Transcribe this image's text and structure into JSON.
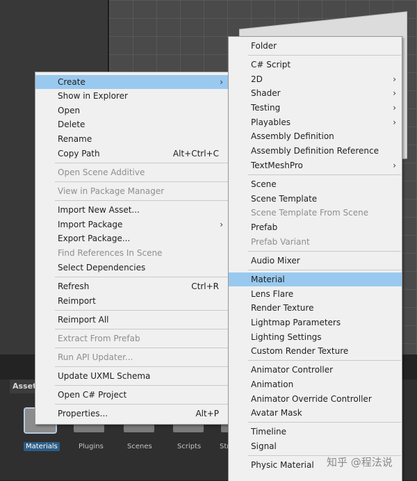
{
  "project": {
    "tab_label": "Asset",
    "folders": [
      "Materials",
      "Plugins",
      "Scenes",
      "Scripts",
      "Str"
    ],
    "selected_folder": "Materials"
  },
  "context_menu": {
    "items": {
      "create": "Create",
      "show_in_explorer": "Show in Explorer",
      "open": "Open",
      "delete": "Delete",
      "rename": "Rename",
      "copy_path": "Copy Path",
      "copy_path_shortcut": "Alt+Ctrl+C",
      "open_scene_additive": "Open Scene Additive",
      "view_in_package_manager": "View in Package Manager",
      "import_new_asset": "Import New Asset...",
      "import_package": "Import Package",
      "export_package": "Export Package...",
      "find_references": "Find References In Scene",
      "select_dependencies": "Select Dependencies",
      "refresh": "Refresh",
      "refresh_shortcut": "Ctrl+R",
      "reimport": "Reimport",
      "reimport_all": "Reimport All",
      "extract_from_prefab": "Extract From Prefab",
      "run_api_updater": "Run API Updater...",
      "update_uxml_schema": "Update UXML Schema",
      "open_csharp_project": "Open C# Project",
      "properties": "Properties...",
      "properties_shortcut": "Alt+P"
    }
  },
  "create_submenu": {
    "items": {
      "folder": "Folder",
      "csharp_script": "C# Script",
      "2d": "2D",
      "shader": "Shader",
      "testing": "Testing",
      "playables": "Playables",
      "assembly_definition": "Assembly Definition",
      "assembly_definition_reference": "Assembly Definition Reference",
      "textmeshpro": "TextMeshPro",
      "scene": "Scene",
      "scene_template": "Scene Template",
      "scene_template_from_scene": "Scene Template From Scene",
      "prefab": "Prefab",
      "prefab_variant": "Prefab Variant",
      "audio_mixer": "Audio Mixer",
      "material": "Material",
      "lens_flare": "Lens Flare",
      "render_texture": "Render Texture",
      "lightmap_parameters": "Lightmap Parameters",
      "lighting_settings": "Lighting Settings",
      "custom_render_texture": "Custom Render Texture",
      "animator_controller": "Animator Controller",
      "animation": "Animation",
      "animator_override_controller": "Animator Override Controller",
      "avatar_mask": "Avatar Mask",
      "timeline": "Timeline",
      "signal": "Signal",
      "physic_material": "Physic Material"
    }
  },
  "icons": {
    "submenu_arrow": "chevron-right-icon",
    "folder": "folder-icon"
  },
  "colors": {
    "highlight": "#99c9ef",
    "menu_bg": "#f0f0f0",
    "selected_folder": "#2c5d87"
  },
  "watermark": "知乎 @程法说"
}
